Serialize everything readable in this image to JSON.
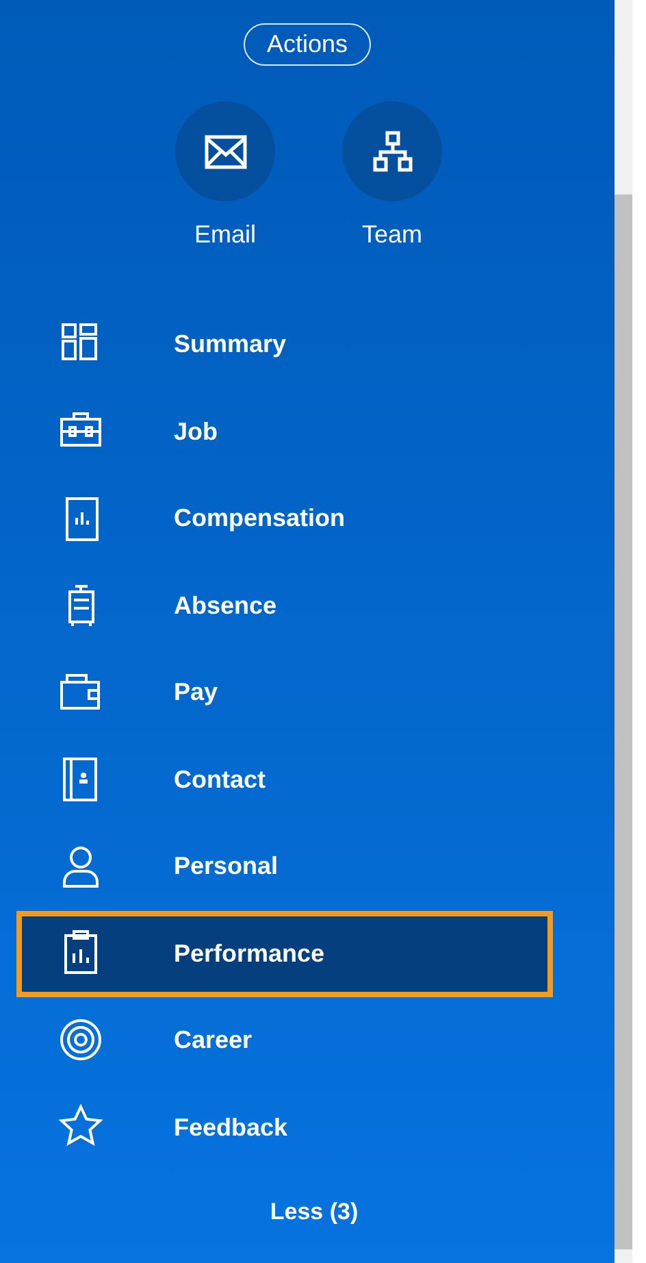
{
  "actions_button": "Actions",
  "quick_actions": [
    {
      "label": "Email"
    },
    {
      "label": "Team"
    }
  ],
  "menu": [
    {
      "label": "Summary",
      "selected": false
    },
    {
      "label": "Job",
      "selected": false
    },
    {
      "label": "Compensation",
      "selected": false
    },
    {
      "label": "Absence",
      "selected": false
    },
    {
      "label": "Pay",
      "selected": false
    },
    {
      "label": "Contact",
      "selected": false
    },
    {
      "label": "Personal",
      "selected": false
    },
    {
      "label": "Performance",
      "selected": true
    },
    {
      "label": "Career",
      "selected": false
    },
    {
      "label": "Feedback",
      "selected": false
    }
  ],
  "less_link": "Less (3)"
}
